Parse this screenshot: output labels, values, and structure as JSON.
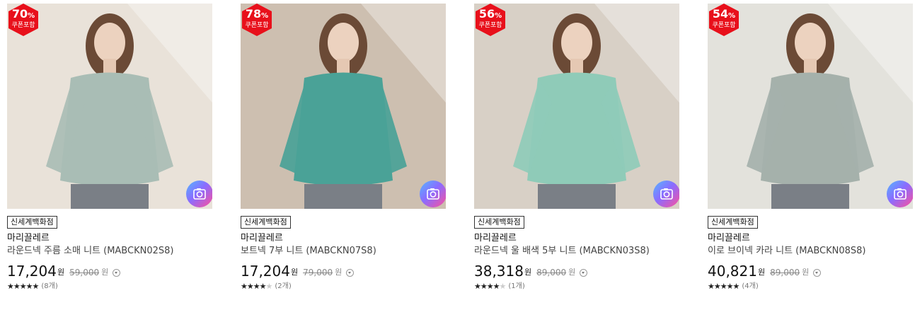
{
  "products": [
    {
      "discount": "70",
      "discount_unit": "%",
      "coupon_label": "쿠폰포함",
      "store": "신세계백화점",
      "brand": "마리끌레르",
      "name": "라운드넥 주름 소매 니트 (MABCKN02S8)",
      "price": "17,204",
      "currency": "원",
      "original_price": "59,000",
      "original_currency": "원",
      "rating": 5,
      "review_count": "(8개)",
      "image_theme": "sage-green round-neck pleated sleeve knit",
      "photo_colors": {
        "bg": "#e9e2d9",
        "garment": "#a9bdb5"
      }
    },
    {
      "discount": "78",
      "discount_unit": "%",
      "coupon_label": "쿠폰포함",
      "store": "신세계백화점",
      "brand": "마리끌레르",
      "name": "보트넥 7부 니트 (MABCKN07S8)",
      "price": "17,204",
      "currency": "원",
      "original_price": "79,000",
      "original_currency": "원",
      "rating": 4,
      "review_count": "(2개)",
      "image_theme": "teal boat-neck knit",
      "photo_colors": {
        "bg": "#cdbfb0",
        "garment": "#4aa297"
      }
    },
    {
      "discount": "56",
      "discount_unit": "%",
      "coupon_label": "쿠폰포함",
      "store": "신세계백화점",
      "brand": "마리끌레르",
      "name": "라운드넥 울 배색 5부 니트 (MABCKN03S8)",
      "price": "38,318",
      "currency": "원",
      "original_price": "89,000",
      "original_currency": "원",
      "rating": 4,
      "review_count": "(1개)",
      "image_theme": "mint mock-neck short sleeve knit",
      "photo_colors": {
        "bg": "#d8d0c6",
        "garment": "#8fcbb8"
      }
    },
    {
      "discount": "54",
      "discount_unit": "%",
      "coupon_label": "쿠폰포함",
      "store": "신세계백화점",
      "brand": "마리끌레르",
      "name": "이로 브이넥 카라 니트 (MABCKN08S8)",
      "price": "40,821",
      "currency": "원",
      "original_price": "89,000",
      "original_currency": "원",
      "rating": 5,
      "review_count": "(4개)",
      "image_theme": "sage collared v-neck knit",
      "photo_colors": {
        "bg": "#e3e2dc",
        "garment": "#a5b1ab"
      }
    }
  ],
  "icons": {
    "badge": "discount-hexagon-icon",
    "camera": "camera-icon",
    "info": "chevron-down-circle-icon",
    "star": "star-icon"
  },
  "colors": {
    "badge_red": "#e8101b",
    "text": "#222222",
    "muted": "#888888"
  }
}
